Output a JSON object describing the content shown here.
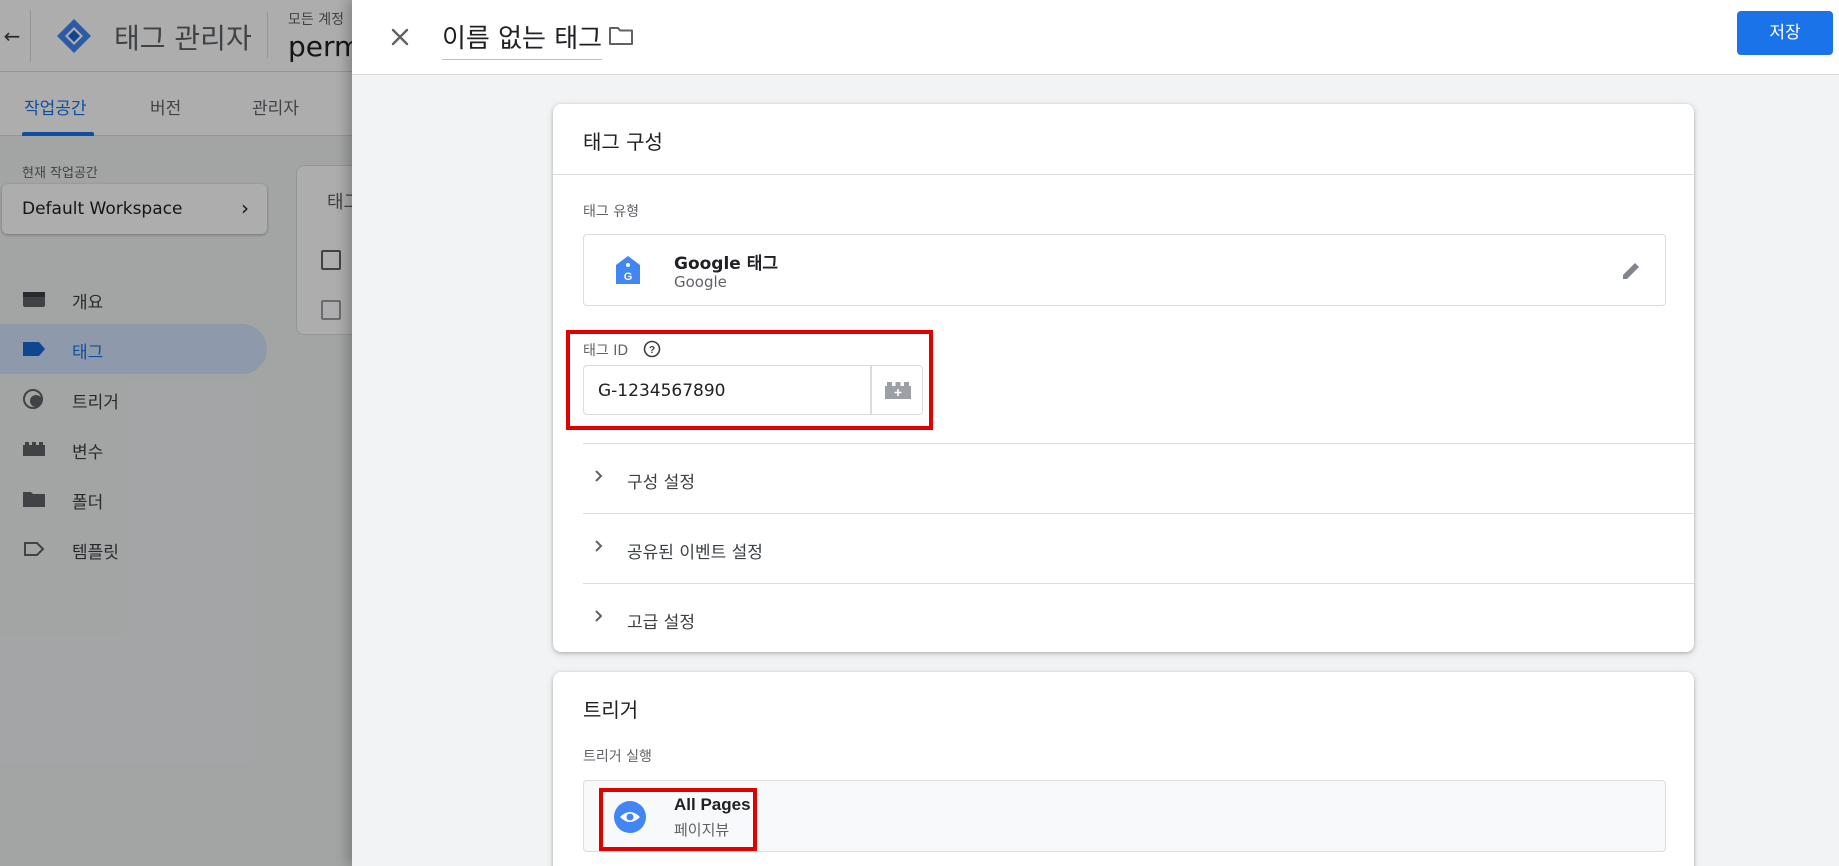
{
  "background": {
    "header": {
      "app_title": "태그 관리자",
      "account_label": "모든 계정",
      "container_name": "perm"
    },
    "tabs": [
      {
        "label": "작업공간",
        "active": true
      },
      {
        "label": "버전",
        "active": false
      },
      {
        "label": "관리자",
        "active": false
      }
    ],
    "workspace": {
      "label": "현재 작업공간",
      "name": "Default Workspace"
    },
    "nav": [
      {
        "label": "개요",
        "icon": "overview-icon",
        "active": false
      },
      {
        "label": "태그",
        "icon": "tag-icon",
        "active": true
      },
      {
        "label": "트리거",
        "icon": "trigger-icon",
        "active": false
      },
      {
        "label": "변수",
        "icon": "variable-icon",
        "active": false
      },
      {
        "label": "폴더",
        "icon": "folder-icon",
        "active": false
      },
      {
        "label": "템플릿",
        "icon": "template-icon",
        "active": false
      }
    ],
    "card_title_partial": "태그"
  },
  "panel": {
    "tag_name": "이름 없는 태그",
    "save_label": "저장",
    "config": {
      "title": "태그 구성",
      "type_label": "태그 유형",
      "type_name": "Google 태그",
      "type_vendor": "Google",
      "id_label": "태그 ID",
      "id_value": "G-1234567890",
      "sections": [
        "구성 설정",
        "공유된 이벤트 설정",
        "고급 설정"
      ]
    },
    "trigger": {
      "title": "트리거",
      "firing_label": "트리거 실행",
      "name": "All Pages",
      "type": "페이지뷰"
    }
  },
  "colors": {
    "accent": "#1a73e8",
    "highlight": "#e00000",
    "scrim": "rgba(0,0,0,0.32)"
  }
}
